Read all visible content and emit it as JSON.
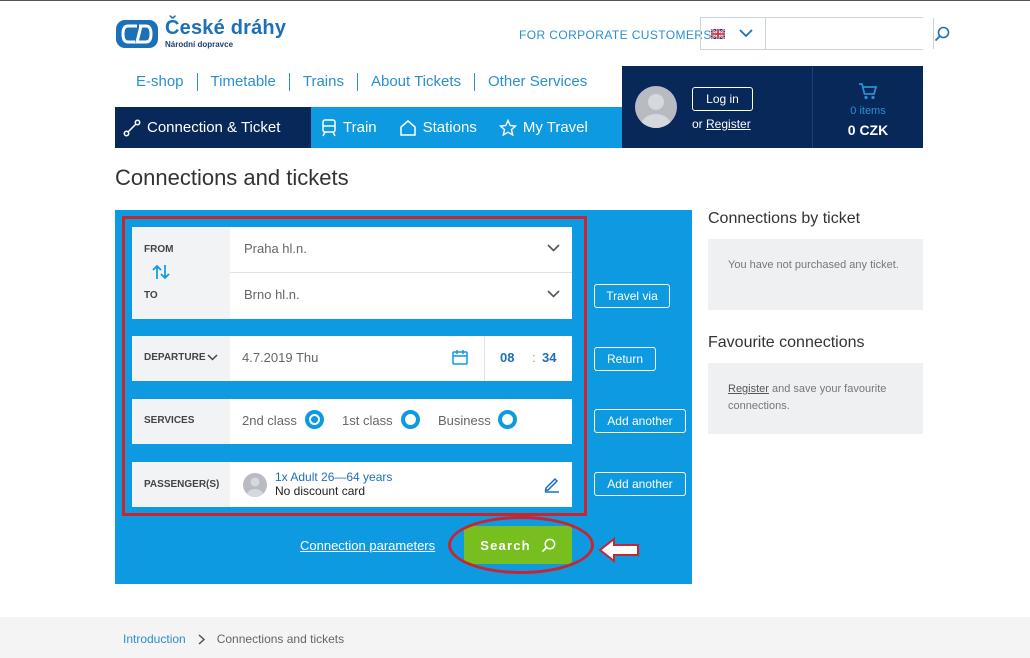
{
  "brand": {
    "title": "České dráhy",
    "subtitle": "Národní dopravce",
    "color": "#1c70b8"
  },
  "header": {
    "corporate_link": "FOR CORPORATE CUSTOMERS",
    "language": "en",
    "search_placeholder": ""
  },
  "main_nav": [
    "E-shop",
    "Timetable",
    "Trains",
    "About Tickets",
    "Other Services"
  ],
  "sub_nav": [
    {
      "label": "Connection & Ticket",
      "icon": "route-icon",
      "active": true
    },
    {
      "label": "Train",
      "icon": "train-icon",
      "active": false
    },
    {
      "label": "Stations",
      "icon": "station-icon",
      "active": false
    },
    {
      "label": "My Travel",
      "icon": "star-icon",
      "active": false
    }
  ],
  "account": {
    "login_label": "Log in",
    "or_text": "or",
    "register_label": "Register",
    "cart_items": "0 items",
    "cart_total": "0 CZK"
  },
  "page_title": "Connections and tickets",
  "form": {
    "from_label": "FROM",
    "from_value": "Praha hl.n.",
    "to_label": "TO",
    "to_value": "Brno hl.n.",
    "travel_via_label": "Travel via",
    "departure_label": "DEPARTURE",
    "date_value": "4.7.2019 Thu",
    "hour_value": "08",
    "minute_value": "34",
    "return_label": "Return",
    "services_label": "SERVICES",
    "classes": [
      {
        "label": "2nd class",
        "selected": true
      },
      {
        "label": "1st class",
        "selected": false
      },
      {
        "label": "Business",
        "selected": false
      }
    ],
    "add_another_label": "Add another",
    "passengers_label": "PASSENGER(S)",
    "passenger_type": "1x Adult 26—64 years",
    "passenger_discount": "No discount card",
    "connection_params_label": "Connection parameters",
    "search_label": "Search"
  },
  "right_column": {
    "by_ticket_title": "Connections by ticket",
    "by_ticket_text": "You have not purchased any ticket.",
    "favourite_title": "Favourite connections",
    "favourite_link": "Register",
    "favourite_text": " and save your favourite connections."
  },
  "breadcrumb": {
    "home": "Introduction",
    "current": "Connections and tickets"
  },
  "colors": {
    "primary_blue": "#0d9ae0",
    "navy": "#08285a",
    "search_green": "#77bf1f",
    "annotation_red": "#c8252f"
  }
}
